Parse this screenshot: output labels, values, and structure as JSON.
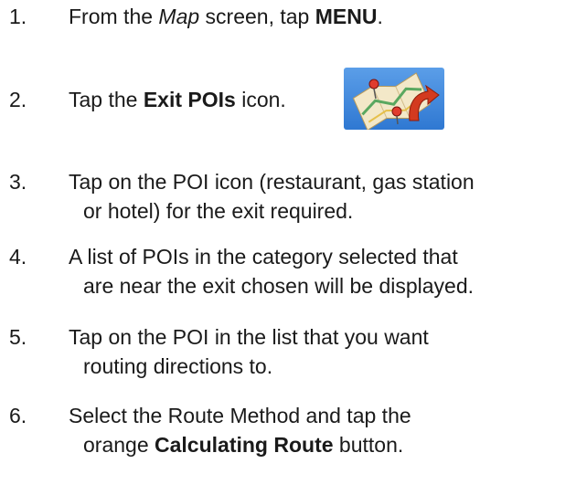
{
  "steps": [
    {
      "number": "1.",
      "parts": [
        "From the ",
        "Map",
        " screen, tap ",
        "MENU",
        "."
      ]
    },
    {
      "number": "2.",
      "parts": [
        "Tap the ",
        "Exit POIs",
        " icon."
      ]
    },
    {
      "number": "3.",
      "line1": "Tap on the POI icon (restaurant, gas station",
      "line2": "or hotel) for the exit required."
    },
    {
      "number": "4.",
      "line1": "A list of POIs in the category selected that",
      "line2": "are near the exit chosen will be displayed."
    },
    {
      "number": "5.",
      "line1": "Tap on the POI in the list that you want",
      "line2": "routing directions to."
    },
    {
      "number": "6.",
      "line1a": "Select the Route Method and tap the",
      "line2": [
        "orange ",
        "Calculating Route",
        " button."
      ]
    }
  ],
  "icon": {
    "name": "exit-pois-map-icon"
  }
}
